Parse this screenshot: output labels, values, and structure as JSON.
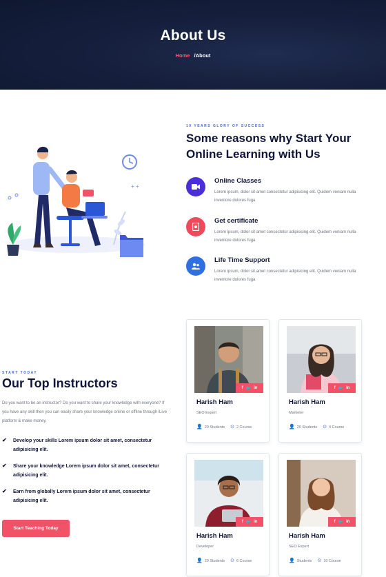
{
  "hero": {
    "title": "About Us",
    "breadcrumb": {
      "home": "Home",
      "separator": "/",
      "current": "About"
    }
  },
  "reasons": {
    "eyebrow": "10 YEARS GLORY OF SUCCESS",
    "title": "Some reasons why Start Your Online Learning with Us",
    "features": [
      {
        "title": "Online Classes",
        "description": "Lorem ipsum, dolor sit amet consectetur adipisicing elit. Quidem veniam nulla inventore dolores fuga",
        "icon": "video-icon",
        "color": "#4a2fd9"
      },
      {
        "title": "Get certificate",
        "description": "Lorem ipsum, dolor sit amet consectetur adipisicing elit. Quidem veniam nulla inventore dolores fuga",
        "icon": "certificate-icon",
        "color": "#ef4a5c"
      },
      {
        "title": "Life Time Support",
        "description": "Lorem ipsum, dolor sit amet consectetur adipisicing elit. Quidem veniam nulla inventore dolores fuga",
        "icon": "users-icon",
        "color": "#2f6fe0"
      }
    ]
  },
  "instructors": {
    "eyebrow": "START TODAY",
    "title": "Our Top Instructors",
    "description": "Do you want to be an instructor? Do you want to share your knowledge with everyone? If you have any skill then you can easily share your knowledge online or offline through iLive platform & make money.",
    "points": [
      "Develop your skills Lorem ipsum dolor sit amet, consectetur adipisicing elit.",
      "Share your knowledge Lorem ipsum dolor sit amet, consectetur adipisicing elit.",
      "Earn from globally Lorem ipsum dolor sit amet, consectetur adipisicing elit."
    ],
    "cta_label": "Start Teaching Today",
    "social": {
      "facebook": "f",
      "twitter": "🐦",
      "linkedin": "in"
    },
    "cards": [
      {
        "name": "Harish Ham",
        "role": "SEO Expert",
        "students": "20 Students",
        "courses": "2 Course"
      },
      {
        "name": "Harish Ham",
        "role": "Marketer",
        "students": "20 Students",
        "courses": "4 Course"
      },
      {
        "name": "Harish Ham",
        "role": "Developer",
        "students": "20 Students",
        "courses": "6 Course"
      },
      {
        "name": "Harish Ham",
        "role": "SEO Expert",
        "students": "Students",
        "courses": "10 Course"
      }
    ]
  },
  "colors": {
    "accent": "#f25268",
    "primary": "#10163a",
    "link": "#3e6bd6"
  }
}
